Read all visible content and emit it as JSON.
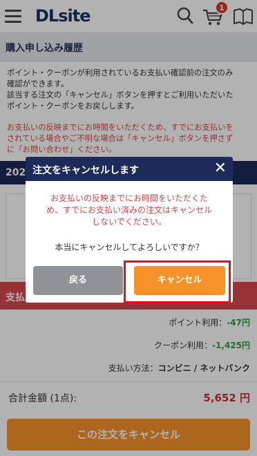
{
  "header": {
    "logo": "DLsite",
    "cart_count": "1",
    "icons": [
      "hamburger-menu-icon",
      "search-icon",
      "cart-icon",
      "book-icon"
    ]
  },
  "page": {
    "title": "購入申し込み履歴",
    "notice_lines": [
      "ポイント・クーポンが利用されているお支払い確認前の注文のみ",
      "確認ができます。",
      "該当する注文の「キャンセル」ボタンを押すとご利用いただいた",
      "ポイント・クーポンをお戻しします。"
    ],
    "warning_lines": [
      "お支払いの反映までにお時間をいただくため、すでにお支払いを",
      "されている場合やご不明な場合は「キャンセル」ボタンを押さず",
      "に「お問い合わせ」ください。"
    ],
    "order_date_partial": "202",
    "payment_label_partial": "支払",
    "point_label": "ポイント利用：",
    "point_value": "-47円",
    "coupon_label": "クーポン利用：",
    "coupon_value": "-1,425円",
    "method_label": "支払い方法：",
    "method_value": "コンビニ / ネットバンク",
    "total_label": "合計金額 (1点):",
    "total_value": "5,652 円",
    "cancel_order_button": "この注文をキャンセル"
  },
  "modal": {
    "title": "注文をキャンセルします",
    "close": "✕",
    "warning_lines": [
      "お支払いの反映までにお時間をいただくた",
      "め、すでにお支払い済みの注文はキャンセル",
      "しないでください。"
    ],
    "confirm": "本当にキャンセルしてよろしいですか？",
    "back_button": "戻る",
    "cancel_button": "キャンセル"
  },
  "colors": {
    "navy": "#1c2b5a",
    "orange": "#f6922a",
    "red_text": "#d6454a",
    "highlight": "#e30e1e"
  }
}
